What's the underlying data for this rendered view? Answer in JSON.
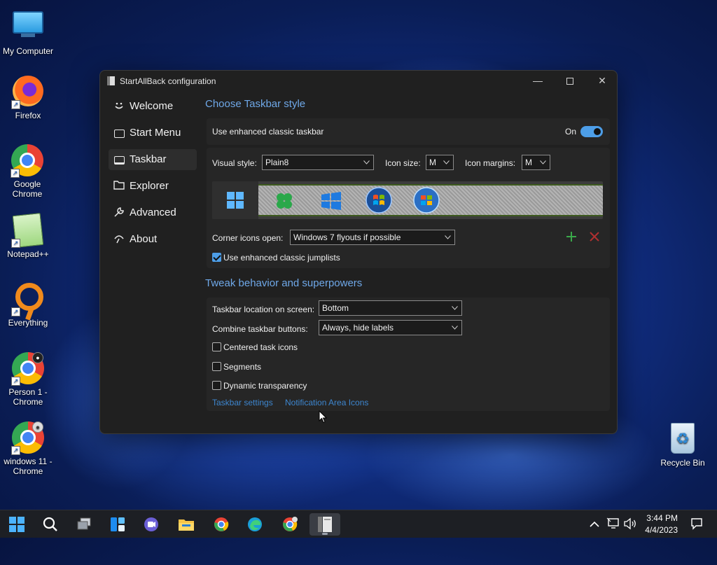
{
  "desktop": {
    "icons": [
      {
        "label": "My Computer"
      },
      {
        "label": "Firefox"
      },
      {
        "label": "Google Chrome"
      },
      {
        "label": "Notepad++"
      },
      {
        "label": "Everything"
      },
      {
        "label": "Person 1 - Chrome"
      },
      {
        "label": "windows 11 - Chrome"
      },
      {
        "label": "Recycle Bin"
      }
    ]
  },
  "window": {
    "title": "StartAllBack configuration",
    "controls": {
      "minimize": "—",
      "close": "✕"
    }
  },
  "sidebar": {
    "items": [
      {
        "label": "Welcome",
        "icon": "smile-icon"
      },
      {
        "label": "Start Menu",
        "icon": "start-menu-icon"
      },
      {
        "label": "Taskbar",
        "icon": "taskbar-icon",
        "active": true
      },
      {
        "label": "Explorer",
        "icon": "folder-icon"
      },
      {
        "label": "Advanced",
        "icon": "wrench-icon"
      },
      {
        "label": "About",
        "icon": "about-icon"
      }
    ]
  },
  "taskbar_style": {
    "heading": "Choose Taskbar style",
    "enhanced_label": "Use enhanced classic taskbar",
    "toggle_state": "On",
    "visual_style_label": "Visual style:",
    "visual_style_value": "Plain8",
    "icon_size_label": "Icon size:",
    "icon_size_value": "M",
    "icon_margins_label": "Icon margins:",
    "icon_margins_value": "M",
    "corner_icons_label": "Corner icons open:",
    "corner_icons_value": "Windows 7 flyouts if possible",
    "jumplists_label": "Use enhanced classic jumplists",
    "jumplists_checked": true
  },
  "tweak": {
    "heading": "Tweak behavior and superpowers",
    "location_label": "Taskbar location on screen:",
    "location_value": "Bottom",
    "combine_label": "Combine taskbar buttons:",
    "combine_value": "Always, hide labels",
    "centered_label": "Centered task icons",
    "segments_label": "Segments",
    "dynamic_label": "Dynamic transparency",
    "link_taskbar_settings": "Taskbar settings",
    "link_notification_icons": "Notification Area Icons"
  },
  "tray": {
    "time": "3:44 PM",
    "date": "4/4/2023"
  },
  "colors": {
    "accent": "#4d9ee8",
    "heading": "#6fa8e8",
    "link": "#3d86cf",
    "window_bg": "#202020",
    "panel_bg": "#262626"
  }
}
